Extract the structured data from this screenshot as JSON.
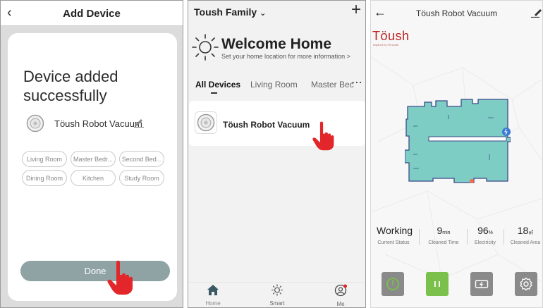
{
  "screen1": {
    "title": "Add Device",
    "back_icon": "chevron-left-icon",
    "message": "Device added successfully",
    "device_name": "Töush Robot Vacuum",
    "rooms": [
      "Living Room",
      "Master Bedr...",
      "Second Bed...",
      "Dining Room",
      "Kitchen",
      "Study Room"
    ],
    "done_label": "Done"
  },
  "screen2": {
    "family_label": "Toush Family",
    "welcome_title": "Welcome Home",
    "welcome_sub": "Set your home location for more information >",
    "tabs": [
      "All Devices",
      "Living Room",
      "Master Bec"
    ],
    "device_name": "Töush Robot Vacuum",
    "nav": [
      "Home",
      "Smart",
      "Me"
    ]
  },
  "screen3": {
    "title": "Töush Robot Vacuum",
    "logo": "Töush",
    "logo_sub": "inspired by Personik",
    "stats": [
      {
        "value": "Working",
        "unit": "",
        "label": "Current Status"
      },
      {
        "value": "9",
        "unit": "min",
        "label": "Cleaned Time"
      },
      {
        "value": "96",
        "unit": "%",
        "label": "Electricity"
      },
      {
        "value": "18",
        "unit": "㎡",
        "label": "Cleaned Area"
      }
    ],
    "controls": [
      "power-icon",
      "pause-icon",
      "charge-icon",
      "settings-icon"
    ]
  },
  "colors": {
    "done_button": "#8fa2a4",
    "map_fill": "#7ecdc4",
    "map_border": "#3c4a8a",
    "control_green": "#7ac04a",
    "control_gray": "#8a8a8a",
    "hand_red": "#e3262a"
  }
}
